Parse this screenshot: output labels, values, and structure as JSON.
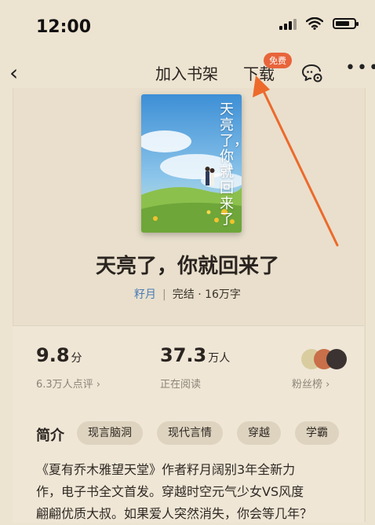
{
  "status_bar": {
    "time": "12:00",
    "battery_level": 0.75
  },
  "nav": {
    "back_icon": "chevron-left-icon",
    "add_to_shelf": "加入书架",
    "download": "下载",
    "download_badge": "免费",
    "chat_icon": "comment-settings-icon",
    "more_icon": "more-dots-icon"
  },
  "book": {
    "cover_title": "天亮了，你就回来了",
    "title": "天亮了，你就回来了",
    "author": "籽月",
    "status": "完结 · 16万字"
  },
  "stats": {
    "rating_value": "9.8",
    "rating_unit": "分",
    "rating_sub": "6.3万人点评 ›",
    "readers_value": "37.3",
    "readers_unit": "万人",
    "readers_sub": "正在阅读",
    "fans_label": "粉丝榜 ›"
  },
  "intro": {
    "label": "简介",
    "tags": [
      "现言脑洞",
      "现代言情",
      "穿越",
      "学霸"
    ],
    "line1": "《夏有乔木雅望天堂》作者籽月阔别3年全新力",
    "line2": "作，电子书全文首发。穿越时空元气少女VS风度",
    "line3": "翩翩优质大叔。如果爱人突然消失，你会等几年？"
  },
  "colors": {
    "accent": "#e8643b",
    "author_link": "#4a7bb7",
    "background": "#ede3d1"
  }
}
